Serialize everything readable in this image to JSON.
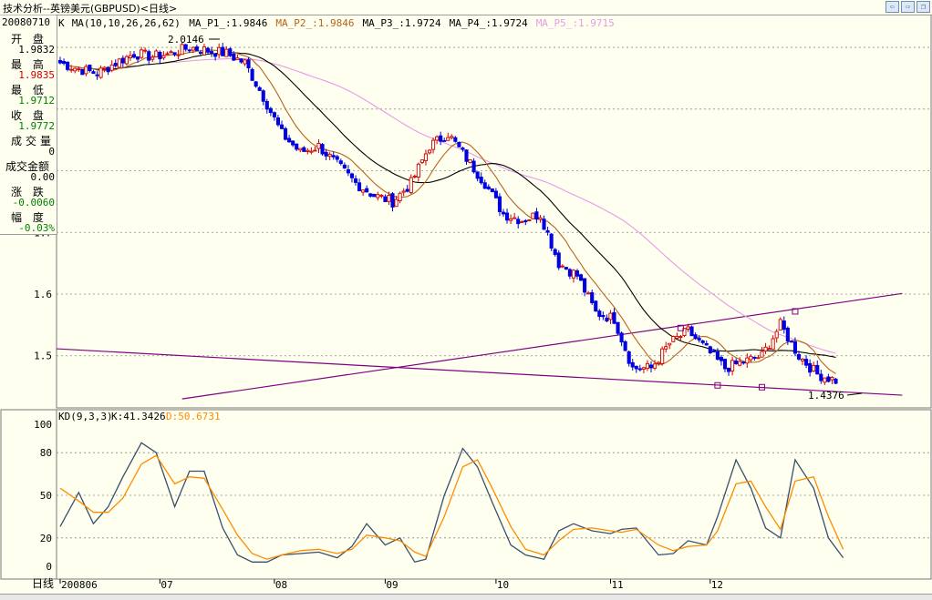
{
  "window": {
    "title": "技术分析--英镑美元(GBPUSD)<日线>",
    "buttons": [
      "back-icon",
      "forward-icon",
      "restore-icon"
    ]
  },
  "info_panel": {
    "date": "20080710",
    "rows": [
      {
        "label": "开 盘",
        "value": "1.9832",
        "color": "#000000"
      },
      {
        "label": "最 高",
        "value": "1.9835",
        "color": "#d00000"
      },
      {
        "label": "最 低",
        "value": "1.9712",
        "color": "#008000"
      },
      {
        "label": "收 盘",
        "value": "1.9772",
        "color": "#008000"
      },
      {
        "label": "成交量",
        "value": "0",
        "color": "#000000"
      },
      {
        "label": "成交金额",
        "value": "0.00",
        "color": "#000000"
      },
      {
        "label": "涨 跌",
        "value": "-0.0060",
        "color": "#008000"
      },
      {
        "label": "幅 度",
        "value": "-0.03%",
        "color": "#008000"
      }
    ]
  },
  "colors": {
    "up": "#d00000",
    "down": "#0000e0",
    "ma1": "#b8621a",
    "ma2": "#000000",
    "ma3": "#e79be7",
    "trendline": "#800080",
    "kd_k": "#3a4f6a",
    "kd_d": "#ff8c00",
    "grid": "#8c8c8c"
  },
  "chart_data": [
    {
      "type": "candlestick",
      "legend": [
        {
          "text": "K",
          "color": "#000000"
        },
        {
          "text": "MA(10,10,26,26,62)",
          "color": "#000000"
        },
        {
          "text": "MA_P1_:1.9846",
          "color": "#000000"
        },
        {
          "text": "MA_P2_:1.9846",
          "color": "#b8621a"
        },
        {
          "text": "MA_P3_:1.9724",
          "color": "#000000"
        },
        {
          "text": "MA_P4_:1.9724",
          "color": "#000000"
        },
        {
          "text": "MA_P5_:1.9715",
          "color": "#e79be7"
        }
      ],
      "yticks": [
        "1.5",
        "1.6",
        "1.7"
      ],
      "ylim": [
        1.43,
        2.07
      ],
      "annotations": {
        "high": "2.0146",
        "low": "1.4376"
      },
      "close_anchors": [
        [
          0,
          1.975
        ],
        [
          5,
          1.965
        ],
        [
          10,
          1.958
        ],
        [
          15,
          1.975
        ],
        [
          20,
          1.99
        ],
        [
          25,
          1.985
        ],
        [
          30,
          1.99
        ],
        [
          35,
          2.0
        ],
        [
          40,
          1.995
        ],
        [
          45,
          1.99
        ],
        [
          50,
          1.975
        ],
        [
          55,
          1.92
        ],
        [
          60,
          1.86
        ],
        [
          65,
          1.83
        ],
        [
          70,
          1.84
        ],
        [
          75,
          1.81
        ],
        [
          80,
          1.78
        ],
        [
          85,
          1.76
        ],
        [
          90,
          1.75
        ],
        [
          95,
          1.78
        ],
        [
          100,
          1.84
        ],
        [
          105,
          1.86
        ],
        [
          110,
          1.82
        ],
        [
          115,
          1.78
        ],
        [
          120,
          1.73
        ],
        [
          125,
          1.72
        ],
        [
          130,
          1.73
        ],
        [
          135,
          1.65
        ],
        [
          140,
          1.63
        ],
        [
          145,
          1.57
        ],
        [
          150,
          1.56
        ],
        [
          155,
          1.48
        ],
        [
          160,
          1.48
        ],
        [
          165,
          1.52
        ],
        [
          170,
          1.54
        ],
        [
          175,
          1.51
        ],
        [
          180,
          1.48
        ],
        [
          185,
          1.49
        ],
        [
          190,
          1.5
        ],
        [
          195,
          1.55
        ],
        [
          200,
          1.5
        ],
        [
          205,
          1.47
        ],
        [
          210,
          1.46
        ]
      ],
      "trendlines": [
        {
          "from": [
            -3,
            1.512
          ],
          "to": [
            228,
            1.436
          ]
        },
        {
          "from": [
            33,
            1.43
          ],
          "to": [
            228,
            1.601
          ]
        }
      ],
      "markers": [
        [
          168,
          1.545
        ],
        [
          178,
          1.452
        ],
        [
          190,
          1.449
        ],
        [
          199,
          1.572
        ]
      ]
    },
    {
      "type": "line",
      "title": "KD(9,3,3)",
      "series": [
        {
          "name": "K:41.3426",
          "color": "#3a4f6a",
          "points": [
            [
              0,
              28
            ],
            [
              5,
              52
            ],
            [
              9,
              30
            ],
            [
              13,
              42
            ],
            [
              17,
              63
            ],
            [
              22,
              87
            ],
            [
              26,
              80
            ],
            [
              31,
              42
            ],
            [
              35,
              67
            ],
            [
              39,
              67
            ],
            [
              44,
              27
            ],
            [
              48,
              8
            ],
            [
              52,
              3
            ],
            [
              56,
              3
            ],
            [
              60,
              8
            ],
            [
              65,
              9
            ],
            [
              70,
              10
            ],
            [
              75,
              6
            ],
            [
              79,
              14
            ],
            [
              83,
              30
            ],
            [
              88,
              15
            ],
            [
              92,
              20
            ],
            [
              96,
              3
            ],
            [
              99,
              5
            ],
            [
              104,
              50
            ],
            [
              109,
              83
            ],
            [
              113,
              70
            ],
            [
              117,
              45
            ],
            [
              122,
              15
            ],
            [
              126,
              8
            ],
            [
              131,
              5
            ],
            [
              135,
              25
            ],
            [
              139,
              30
            ],
            [
              144,
              25
            ],
            [
              149,
              23
            ],
            [
              152,
              26
            ],
            [
              156,
              27
            ],
            [
              162,
              8
            ],
            [
              166,
              9
            ],
            [
              170,
              18
            ],
            [
              175,
              15
            ],
            [
              178,
              35
            ],
            [
              183,
              75
            ],
            [
              187,
              55
            ],
            [
              191,
              27
            ],
            [
              195,
              20
            ],
            [
              199,
              75
            ],
            [
              204,
              55
            ],
            [
              208,
              20
            ],
            [
              212,
              6
            ]
          ]
        },
        {
          "name": "D:50.6731",
          "color": "#ff8c00",
          "points": [
            [
              0,
              55
            ],
            [
              5,
              46
            ],
            [
              9,
              38
            ],
            [
              13,
              38
            ],
            [
              17,
              48
            ],
            [
              22,
              72
            ],
            [
              26,
              78
            ],
            [
              31,
              58
            ],
            [
              35,
              63
            ],
            [
              39,
              62
            ],
            [
              44,
              40
            ],
            [
              48,
              22
            ],
            [
              52,
              9
            ],
            [
              56,
              5
            ],
            [
              60,
              8
            ],
            [
              65,
              11
            ],
            [
              70,
              12
            ],
            [
              75,
              9
            ],
            [
              79,
              12
            ],
            [
              83,
              22
            ],
            [
              88,
              20
            ],
            [
              92,
              18
            ],
            [
              96,
              10
            ],
            [
              99,
              7
            ],
            [
              104,
              35
            ],
            [
              109,
              70
            ],
            [
              113,
              75
            ],
            [
              117,
              55
            ],
            [
              122,
              28
            ],
            [
              126,
              12
            ],
            [
              131,
              8
            ],
            [
              135,
              18
            ],
            [
              139,
              26
            ],
            [
              144,
              27
            ],
            [
              149,
              25
            ],
            [
              152,
              24
            ],
            [
              156,
              26
            ],
            [
              162,
              15
            ],
            [
              166,
              11
            ],
            [
              170,
              14
            ],
            [
              175,
              15
            ],
            [
              178,
              25
            ],
            [
              183,
              58
            ],
            [
              187,
              60
            ],
            [
              191,
              42
            ],
            [
              195,
              26
            ],
            [
              199,
              60
            ],
            [
              204,
              63
            ],
            [
              208,
              35
            ],
            [
              212,
              12
            ]
          ]
        }
      ],
      "yticks": [
        "0",
        "20",
        "50",
        "80",
        "100"
      ],
      "ylim": [
        0,
        105
      ]
    }
  ],
  "x_axis": {
    "label": "日线",
    "ticks": [
      {
        "label": "200806",
        "i": 0
      },
      {
        "label": "07",
        "i": 27
      },
      {
        "label": "08",
        "i": 58
      },
      {
        "label": "09",
        "i": 88
      },
      {
        "label": "10",
        "i": 118
      },
      {
        "label": "11",
        "i": 149
      },
      {
        "label": "12",
        "i": 176
      }
    ]
  }
}
